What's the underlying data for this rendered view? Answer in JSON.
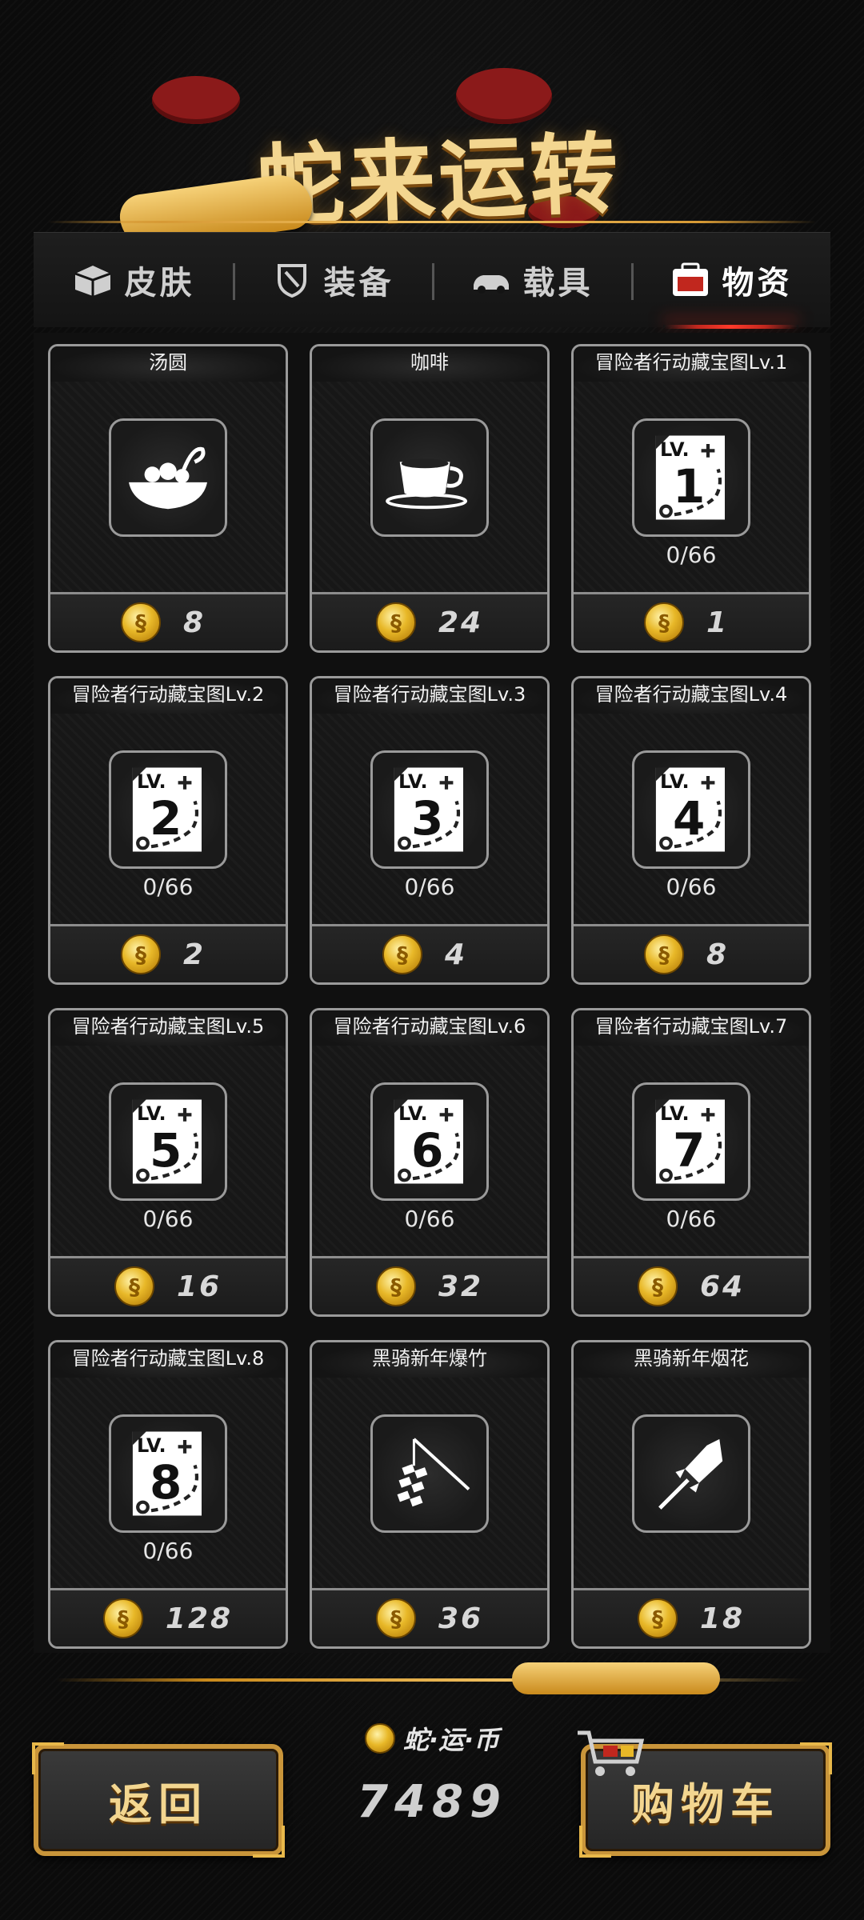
{
  "header": {
    "title": "蛇来运转"
  },
  "tabs": [
    {
      "label": "皮肤",
      "icon": "box-icon",
      "active": false
    },
    {
      "label": "装备",
      "icon": "shield-icon",
      "active": false
    },
    {
      "label": "载具",
      "icon": "car-icon",
      "active": false
    },
    {
      "label": "物资",
      "icon": "supplies-icon",
      "active": true
    }
  ],
  "items": [
    {
      "name": "汤圆",
      "icon": "tangyuan-bowl-icon",
      "progress": "",
      "price": "8"
    },
    {
      "name": "咖啡",
      "icon": "coffee-cup-icon",
      "progress": "",
      "price": "24"
    },
    {
      "name": "冒险者行动藏宝图Lv.1",
      "icon": "treasure-map-icon",
      "level": "1",
      "progress": "0/66",
      "price": "1"
    },
    {
      "name": "冒险者行动藏宝图Lv.2",
      "icon": "treasure-map-icon",
      "level": "2",
      "progress": "0/66",
      "price": "2"
    },
    {
      "name": "冒险者行动藏宝图Lv.3",
      "icon": "treasure-map-icon",
      "level": "3",
      "progress": "0/66",
      "price": "4"
    },
    {
      "name": "冒险者行动藏宝图Lv.4",
      "icon": "treasure-map-icon",
      "level": "4",
      "progress": "0/66",
      "price": "8"
    },
    {
      "name": "冒险者行动藏宝图Lv.5",
      "icon": "treasure-map-icon",
      "level": "5",
      "progress": "0/66",
      "price": "16"
    },
    {
      "name": "冒险者行动藏宝图Lv.6",
      "icon": "treasure-map-icon",
      "level": "6",
      "progress": "0/66",
      "price": "32"
    },
    {
      "name": "冒险者行动藏宝图Lv.7",
      "icon": "treasure-map-icon",
      "level": "7",
      "progress": "0/66",
      "price": "64"
    },
    {
      "name": "冒险者行动藏宝图Lv.8",
      "icon": "treasure-map-icon",
      "level": "8",
      "progress": "0/66",
      "price": "128"
    },
    {
      "name": "黑骑新年爆竹",
      "icon": "firecracker-icon",
      "progress": "",
      "price": "36"
    },
    {
      "name": "黑骑新年烟花",
      "icon": "firework-rocket-icon",
      "progress": "",
      "price": "18"
    }
  ],
  "map_label_prefix": "LV.",
  "footer": {
    "back_label": "返回",
    "cart_label": "购物车",
    "currency_name": "蛇·运·币",
    "currency_amount": "7489"
  },
  "colors": {
    "accent_gold": "#f3d690",
    "tab_active_red": "#ff3a2a",
    "background": "#0b0b0b"
  }
}
